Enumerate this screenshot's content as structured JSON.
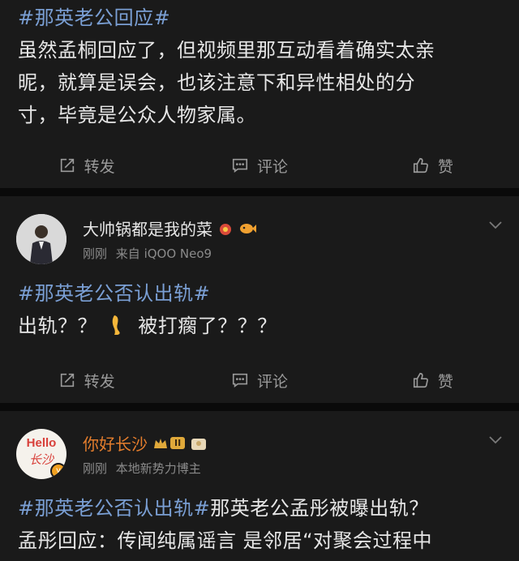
{
  "post1": {
    "hashtag": "#那英老公回应#",
    "line1": "虽然孟桐回应了，但视频里那互动看着确实太亲",
    "line2": "昵，就算是误会，也该注意下和异性相处的分",
    "line3": "寸，毕竟是公众人物家属。",
    "repost": "转发",
    "comment": "评论",
    "like": "赞"
  },
  "post2": {
    "username": "大帅锅都是我的菜",
    "time": "刚刚",
    "source": "来自 iQOO Neo9",
    "hashtag": "#那英老公否认出轨#",
    "text_a": "出轨？？",
    "text_b": "被打瘸了？？？",
    "repost": "转发",
    "comment": "评论",
    "like": "赞"
  },
  "post3": {
    "avatar_text": "Hello",
    "avatar_script": "长沙",
    "username": "你好长沙",
    "level": "II",
    "time": "刚刚",
    "source": "本地新势力博主",
    "hashtag": "#那英老公否认出轨#",
    "line1_rest": "那英老公孟彤被曝出轨？",
    "line2": "孟彤回应：传闻纯属谣言 是邻居“对聚会过程中"
  },
  "colors": {
    "hashtag": "#7a9fd4",
    "orange_name": "#e57e2d",
    "background": "#1a1a1a"
  },
  "icons": [
    "repost-icon",
    "comment-icon",
    "like-icon",
    "chevron-down-icon"
  ]
}
